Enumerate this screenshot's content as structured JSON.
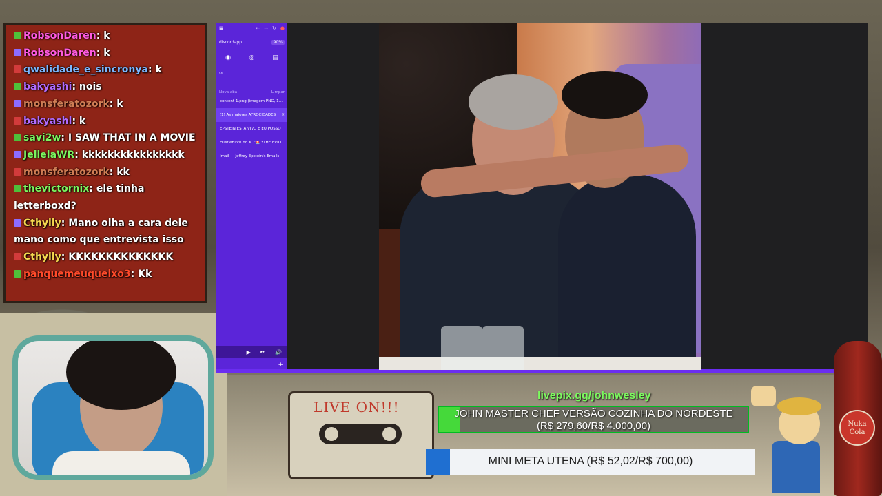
{
  "chat": {
    "messages": [
      {
        "user": "RobsonDaren",
        "sep": ":",
        "text": " k",
        "color": "pink"
      },
      {
        "user": "RobsonDaren",
        "sep": ":",
        "text": " k",
        "color": "pink"
      },
      {
        "user": "qwalidade_e_sincronya",
        "sep": ":",
        "text": " k",
        "color": "blue"
      },
      {
        "user": "bakyashi",
        "sep": ":",
        "text": " nois",
        "color": "purple"
      },
      {
        "user": "monsferatozork",
        "sep": ":",
        "text": " k",
        "color": "orange"
      },
      {
        "user": "bakyashi",
        "sep": ":",
        "text": " k",
        "color": "purple"
      },
      {
        "user": "savi2w",
        "sep": ":",
        "text": " I SAW THAT IN A MOVIE",
        "color": "green"
      },
      {
        "user": "JelleiaWR",
        "sep": ":",
        "text": " kkkkkkkkkkkkkkkk",
        "color": "green"
      },
      {
        "user": "monsferatozork",
        "sep": ":",
        "text": " kk",
        "color": "orange"
      },
      {
        "user": "thevictornix",
        "sep": ":",
        "text": " ele tinha letterboxd?",
        "color": "green"
      },
      {
        "user": "Cthylly",
        "sep": ":",
        "text": " Mano olha a cara dele mano como que entrevista isso",
        "color": "gold"
      },
      {
        "user": "Cthylly",
        "sep": ":",
        "text": " KKKKKKKKKKKKKK",
        "color": "gold"
      },
      {
        "user": "panquemeuqueixo3",
        "sep": ":",
        "text": " Kk",
        "color": "red"
      }
    ]
  },
  "browser": {
    "url": "discordapp",
    "zoom": "90%",
    "label": "ce",
    "section_label": "Nova aba",
    "clear_label": "Limpar",
    "tabs": [
      {
        "title": "content-1.png (imagem PNG, 10..."
      },
      {
        "title": "(1) As maiores ATROCIDADES",
        "active": true
      },
      {
        "title": "EPSTEIN ESTÁ VIVO E EU POSSO"
      },
      {
        "title": "HustleBitch no X: \"🚨 *THE EVID"
      },
      {
        "title": "Jmail — Jeffrey Epstein's Emails"
      }
    ],
    "media_controls": [
      "▶",
      "⏭",
      "🔊"
    ],
    "plus": "+"
  },
  "overlay": {
    "tape_title": "LIVE ON!!!",
    "livepix": "livepix.gg/johnwesley",
    "goal1": {
      "label": "JOHN MASTER CHEF VERSÃO COZINHA DO NORDESTE",
      "amount": "(R$ 279,60/R$ 4.000,00)",
      "fraction": 0.07
    },
    "goal2": {
      "label": "MINI META UTENA (R$ 52,02/R$ 700,00)",
      "fraction": 0.074
    },
    "bottle_label": "Nuka Cola"
  }
}
